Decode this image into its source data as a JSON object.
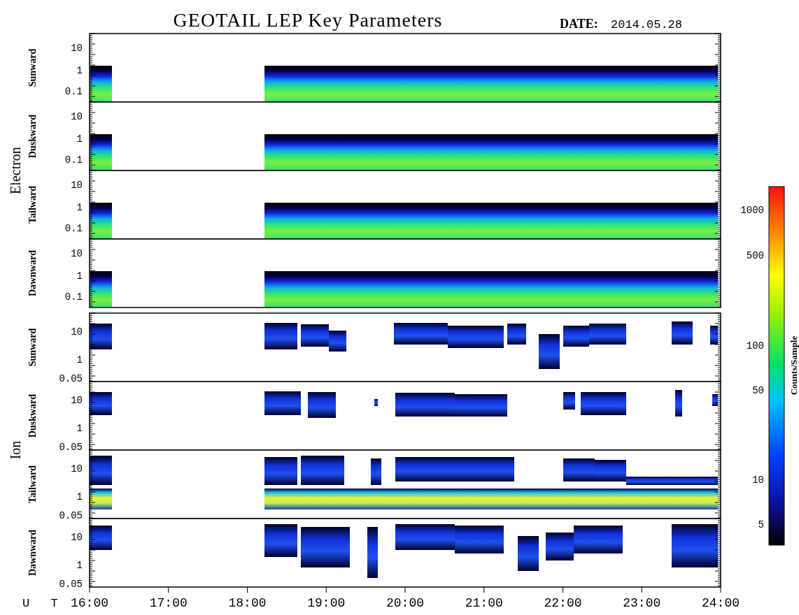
{
  "title": "GEOTAIL LEP Key Parameters",
  "date": {
    "label": "DATE:",
    "value": "2014.05.28"
  },
  "species": [
    {
      "name": "Electron",
      "panels": [
        {
          "direction": "Sunward",
          "yticks": [
            "10",
            "1",
            "0.1"
          ]
        },
        {
          "direction": "Duskward",
          "yticks": [
            "10",
            "1",
            "0.1"
          ]
        },
        {
          "direction": "Tailward",
          "yticks": [
            "10",
            "1",
            "0.1"
          ]
        },
        {
          "direction": "Dawnward",
          "yticks": [
            "10",
            "1",
            "0.1"
          ]
        }
      ]
    },
    {
      "name": "Ion",
      "panels": [
        {
          "direction": "Sunward",
          "yticks": [
            "10",
            "1",
            "0.05"
          ]
        },
        {
          "direction": "Duskward",
          "yticks": [
            "10",
            "1",
            "0.05"
          ]
        },
        {
          "direction": "Tailward",
          "yticks": [
            "10",
            "1",
            "0.05"
          ]
        },
        {
          "direction": "Dawnward",
          "yticks": [
            "10",
            "1",
            "0.05"
          ]
        }
      ]
    }
  ],
  "x_axis": {
    "label": "U T",
    "ticks": [
      "16:00",
      "17:00",
      "18:00",
      "19:00",
      "20:00",
      "21:00",
      "22:00",
      "23:00",
      "24:00"
    ]
  },
  "colorbar": {
    "title": "Counts/Sample",
    "ticks": [
      "1000",
      "500",
      "100",
      "50",
      "10",
      "5"
    ]
  }
}
